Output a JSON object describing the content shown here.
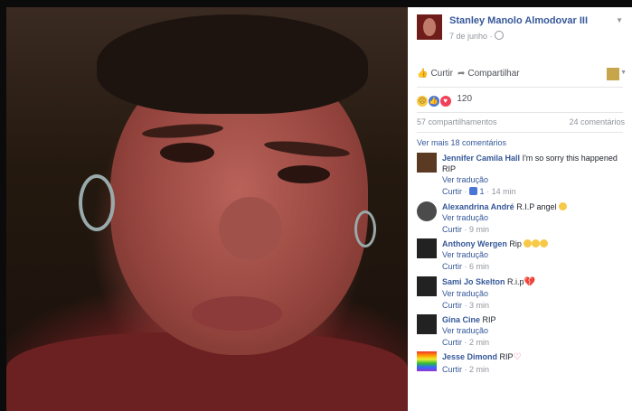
{
  "post": {
    "author": "Stanley Manolo Almodovar III",
    "date": "7 de junho",
    "date_sep": "·",
    "actions": {
      "like": "Curtir",
      "share": "Compartilhar"
    },
    "reactions": {
      "count": "120",
      "types": [
        "sad-icon",
        "like-icon",
        "love-icon"
      ]
    },
    "shares": "57 compartilhamentos",
    "comments_count": "24 comentários",
    "more_comments": "Ver mais 18 comentários"
  },
  "comments": [
    {
      "name": "Jennifer Camila Hall",
      "text": "I'm so sorry this happened RIP",
      "translate": "Ver tradução",
      "like": "Curtir",
      "sep": "·",
      "likes": "1",
      "time": "14 min"
    },
    {
      "name": "Alexandrina André",
      "text": "R.I.P angel",
      "translate": "Ver tradução",
      "like": "Curtir",
      "sep": "·",
      "time": "9 min"
    },
    {
      "name": "Anthony Wergen",
      "text": "Rip",
      "translate": "Ver tradução",
      "like": "Curtir",
      "sep": "·",
      "time": "6 min"
    },
    {
      "name": "Sami Jo Skelton",
      "text": "R.i.p",
      "translate": "Ver tradução",
      "like": "Curtir",
      "sep": "·",
      "time": "3 min"
    },
    {
      "name": "Gina Cine",
      "text": "RIP",
      "translate": "Ver tradução",
      "like": "Curtir",
      "sep": "·",
      "time": "2 min"
    },
    {
      "name": "Jesse Dimond",
      "text": "RIP",
      "like": "Curtir",
      "sep": "·",
      "time": "2 min"
    }
  ],
  "colors": {
    "link": "#365899",
    "meta": "#90949c",
    "text": "#1d2129"
  }
}
